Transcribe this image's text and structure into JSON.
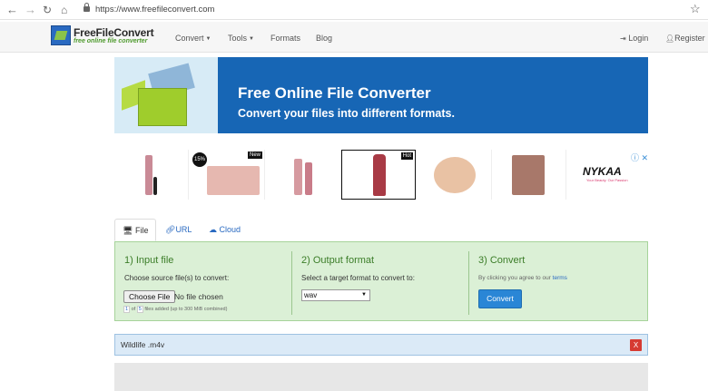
{
  "browser": {
    "url": "https://www.freefileconvert.com"
  },
  "nav": {
    "logo_title": "FreeFileConvert",
    "logo_sub": "free online file converter",
    "menu": [
      {
        "label": "Convert",
        "has_caret": true
      },
      {
        "label": "Tools",
        "has_caret": true
      },
      {
        "label": "Formats",
        "has_caret": false
      },
      {
        "label": "Blog",
        "has_caret": false
      }
    ],
    "login": "Login",
    "register": "Register"
  },
  "banner": {
    "title": "Free Online File Converter",
    "subtitle": "Convert your files into different formats."
  },
  "ads": {
    "badges": {
      "item1": "15%",
      "item2": "New",
      "item4": "Hot"
    },
    "nykaa_logo": "NYKAA",
    "nykaa_tagline": "Your Beauty. Our Passion",
    "info_icon": "ⓘ ✕"
  },
  "tabs": [
    {
      "label": "File",
      "icon": "monitor-icon",
      "active": true
    },
    {
      "label": "URL",
      "icon": "link-icon",
      "active": false
    },
    {
      "label": "Cloud",
      "icon": "cloud-icon",
      "active": false
    }
  ],
  "converter": {
    "input": {
      "title": "1) Input file",
      "desc": "Choose source file(s) to convert:",
      "choose_button": "Choose File",
      "file_status": "No file chosen",
      "count_current": "1",
      "count_of": "of",
      "count_max": "5",
      "count_suffix": "files added (up to 300 MiB combined)"
    },
    "output": {
      "title": "2) Output format",
      "desc": "Select a target format to convert to:",
      "selected_format": "wav"
    },
    "convert": {
      "title": "3) Convert",
      "terms_prefix": "By clicking you agree to our",
      "terms_link": "terms",
      "button": "Convert"
    }
  },
  "file_list": {
    "filename": "Wildlife .m4v",
    "remove_label": "X"
  }
}
